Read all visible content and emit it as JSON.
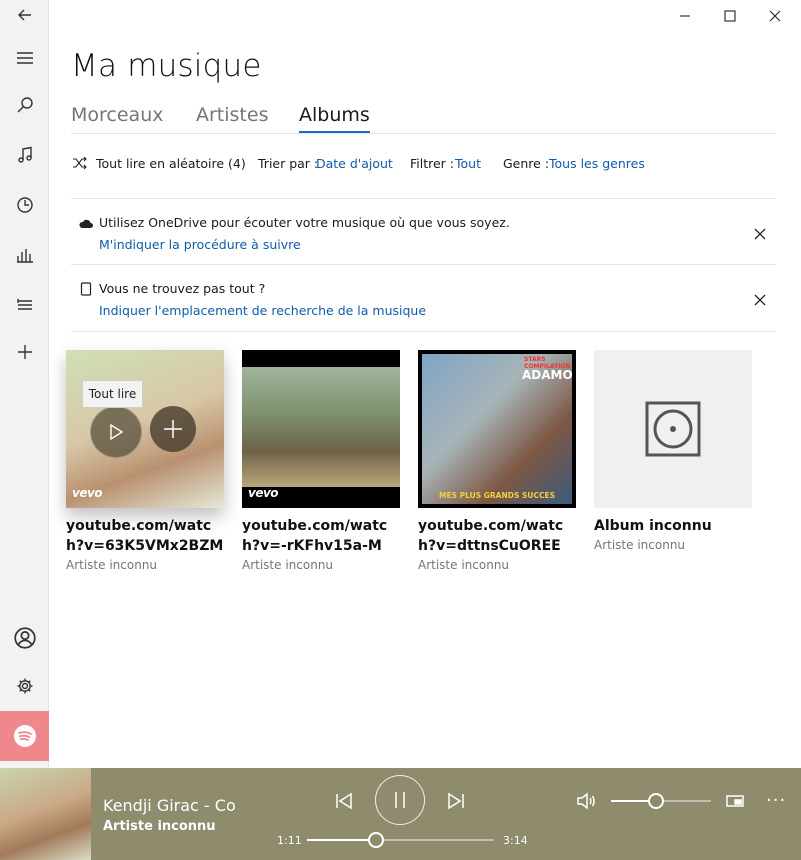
{
  "page": {
    "title": "Ma musique"
  },
  "tabs": [
    {
      "label": "Morceaux",
      "active": false
    },
    {
      "label": "Artistes",
      "active": false
    },
    {
      "label": "Albums",
      "active": true
    }
  ],
  "filters": {
    "shuffle_label": "Tout lire en aléatoire (4)",
    "sort_label": "Trier par :",
    "sort_value": "Date d'ajout",
    "filter_label": "Filtrer :",
    "filter_value": "Tout",
    "genre_label": "Genre :",
    "genre_value": "Tous les genres"
  },
  "banners": [
    {
      "icon": "cloud-icon",
      "text": "Utilisez OneDrive pour écouter votre musique où que vous soyez.",
      "link": "M'indiquer la procédure à suivre"
    },
    {
      "icon": "device-icon",
      "text": "Vous ne trouvez pas tout ?",
      "link": "Indiquer l'emplacement de recherche de la musique"
    }
  ],
  "albums": [
    {
      "title": "youtube.com/watch?v=63K5VMx2BZM",
      "artist": "Artiste inconnu",
      "watermark": "vevo"
    },
    {
      "title": "youtube.com/watch?v=-rKFhv15a-M",
      "artist": "Artiste inconnu",
      "watermark": "vevo"
    },
    {
      "title": "youtube.com/watch?v=dttnsCuOREE",
      "artist": "Artiste inconnu",
      "cover_text": "ADAMO",
      "cover_top": "STARS COMPILATION",
      "cover_bottom": "MES PLUS GRANDS SUCCES"
    },
    {
      "title": "Album inconnu",
      "artist": "Artiste inconnu"
    }
  ],
  "tooltip": "Tout lire",
  "player": {
    "now_playing_title": "Kendji Girac - Col",
    "now_playing_artist": "Artiste inconnu",
    "elapsed": "1:11",
    "total": "3:14",
    "progress_fraction": 0.37,
    "volume_fraction": 0.45,
    "more_label": "···"
  },
  "colors": {
    "accent": "#1a6fc4",
    "link": "#0e5ca8",
    "player_bg": "#8e8c6c",
    "spotify": "#f0878c"
  },
  "icons": {
    "rail": [
      "back-icon",
      "hamburger-icon",
      "search-icon",
      "music-note-icon",
      "recent-icon",
      "now-playing-icon",
      "playlist-icon",
      "add-icon",
      "account-icon",
      "settings-icon",
      "spotify-icon"
    ]
  }
}
